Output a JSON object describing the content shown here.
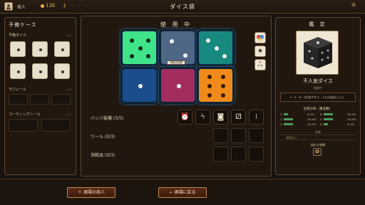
{
  "header": {
    "player_name": "商人",
    "gold": "136",
    "key_text": "— — —",
    "title": "ダイス袋"
  },
  "left": {
    "title": "予備ケース",
    "dice_label": "予備ダイス",
    "dice_count": "6/6",
    "module_label": "モジュール",
    "module_count": "0/3",
    "coating_label": "コーティングシール",
    "coating_count": "0/2"
  },
  "center": {
    "title": "使 用 中",
    "tooltip": "消耗品効果",
    "badge_label": "バッジ装備 (5/5)",
    "tool_label": "ツール (0/3)",
    "consumable_label": "消耗品 (0/3)",
    "dice": [
      {
        "color": "#3fe38a",
        "face": 5
      },
      {
        "color": "#4e6784",
        "face": 2
      },
      {
        "color": "#18897e",
        "face": 3
      },
      {
        "color": "#1b4c8c",
        "face": 1
      },
      {
        "color": "#a22d5e",
        "face": 1
      },
      {
        "color": "#f08a1a",
        "face": 6
      }
    ],
    "side_icons": [
      "palette-icon",
      "star-icon",
      "swirl-icon"
    ],
    "badges": [
      "alarm-icon",
      "lightning-icon",
      "target-icon",
      "dice-pair-icon",
      "needle-icon"
    ]
  },
  "right": {
    "title": "鑑 定",
    "die_name": "不人気ダイス",
    "status": "装備中",
    "description": "2・3・4・5が出やすく、1と6は出にくい。",
    "dist_title": "出目分布（重変動）",
    "dist": [
      {
        "face": "1",
        "pct": "8.3%",
        "fill": 0.2
      },
      {
        "face": "2",
        "pct": "16.6%",
        "fill": 0.4
      },
      {
        "face": "3",
        "pct": "16.6%",
        "fill": 0.4
      },
      {
        "face": "4",
        "pct": "16.6%",
        "fill": 0.4
      },
      {
        "face": "5",
        "pct": "16.6%",
        "fill": 0.4
      },
      {
        "face": "6",
        "pct": "8.3%",
        "fill": 0.2
      }
    ],
    "dist_pct_right": [
      "16.6%",
      "16.6%",
      "8.3%"
    ],
    "effect_title": "効果",
    "effect_value": "効果なし",
    "equip_label": "組める装備"
  },
  "footer": {
    "left_button": "＋ 酒場の商人",
    "right_button": "← 酒場に戻る"
  },
  "colors": {
    "accent": "#b98a4c",
    "panel": "#21170f"
  }
}
